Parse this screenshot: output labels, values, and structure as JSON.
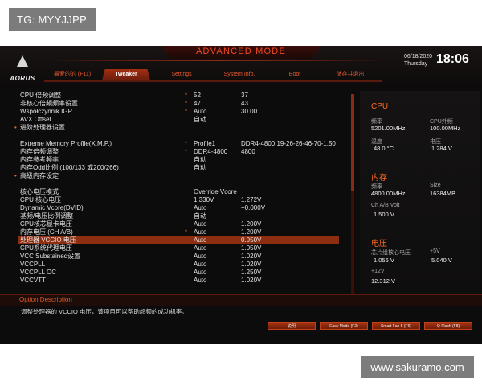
{
  "overlay": {
    "tg_label": "TG: MYYJJPP",
    "watermark_url": "www.sakuramo.com"
  },
  "header": {
    "brand": "AORUS",
    "mode_title": "ADVANCED MODE",
    "date": "06/18/2020",
    "weekday": "Thursday",
    "time": "18:06"
  },
  "tabs": [
    {
      "label": "最爱的的 (F11)",
      "active": false
    },
    {
      "label": "Tweaker",
      "active": true
    },
    {
      "label": "Settings",
      "active": false
    },
    {
      "label": "System Info.",
      "active": false
    },
    {
      "label": "Boot",
      "active": false
    },
    {
      "label": "储存并退出",
      "active": false
    }
  ],
  "settings": [
    {
      "label": "CPU 倍频调整",
      "star": true,
      "v1": "52",
      "v2": "37",
      "bullet": false,
      "selected": false
    },
    {
      "label": "非核心倍频频率设置",
      "star": true,
      "v1": "47",
      "v2": "43",
      "bullet": false,
      "selected": false
    },
    {
      "label": "Współczynnik IGP",
      "star": true,
      "v1": "Auto",
      "v2": "30.00",
      "bullet": false,
      "selected": false
    },
    {
      "label": "AVX Offset",
      "star": false,
      "v1": "自动",
      "v2": "",
      "bullet": false,
      "selected": false
    },
    {
      "label": "进阶处理器设置",
      "star": false,
      "v1": "",
      "v2": "",
      "bullet": true,
      "selected": false
    },
    {
      "label": "",
      "star": false,
      "v1": "",
      "v2": "",
      "bullet": false,
      "selected": false
    },
    {
      "label": "Extreme Memory Profile(X.M.P.)",
      "star": true,
      "v1": "Profile1",
      "v2": "DDR4-4800 19-26-26-46-70-1.50",
      "bullet": false,
      "selected": false
    },
    {
      "label": "内存倍频调整",
      "star": true,
      "v1": "DDR4-4800",
      "v2": "4800",
      "bullet": false,
      "selected": false
    },
    {
      "label": "内存参考频率",
      "star": false,
      "v1": "自动",
      "v2": "",
      "bullet": false,
      "selected": false
    },
    {
      "label": "内存Odd比例 (100/133 或200/266)",
      "star": false,
      "v1": "自动",
      "v2": "",
      "bullet": false,
      "selected": false
    },
    {
      "label": "高级内存设定",
      "star": false,
      "v1": "",
      "v2": "",
      "bullet": true,
      "selected": false
    },
    {
      "label": "",
      "star": false,
      "v1": "",
      "v2": "",
      "bullet": false,
      "selected": false
    },
    {
      "label": "核心电压模式",
      "star": false,
      "v1": "Override Vcore",
      "v2": "",
      "bullet": false,
      "selected": false
    },
    {
      "label": "CPU 核心电压",
      "star": false,
      "v1": "1.330V",
      "v2": "1.272V",
      "bullet": false,
      "selected": false
    },
    {
      "label": "Dynamic Vcore(DVID)",
      "star": false,
      "v1": "Auto",
      "v2": "+0.000V",
      "bullet": false,
      "selected": false
    },
    {
      "label": "基频/电压比例调整",
      "star": false,
      "v1": "自动",
      "v2": "",
      "bullet": false,
      "selected": false
    },
    {
      "label": "CPU核芯显卡电压",
      "star": false,
      "v1": "Auto",
      "v2": "1.200V",
      "bullet": false,
      "selected": false
    },
    {
      "label": "内存电压 (CH A/B)",
      "star": true,
      "v1": "Auto",
      "v2": "1.200V",
      "bullet": false,
      "selected": false
    },
    {
      "label": "处理器 VCCIO 电压",
      "star": false,
      "v1": "Auto",
      "v2": "0.950V",
      "bullet": false,
      "selected": true
    },
    {
      "label": "CPU系统代理电压",
      "star": false,
      "v1": "Auto",
      "v2": "1.050V",
      "bullet": false,
      "selected": false
    },
    {
      "label": "VCC Substained设置",
      "star": false,
      "v1": "Auto",
      "v2": "1.020V",
      "bullet": false,
      "selected": false
    },
    {
      "label": "VCCPLL",
      "star": false,
      "v1": "Auto",
      "v2": "1.020V",
      "bullet": false,
      "selected": false
    },
    {
      "label": "VCCPLL OC",
      "star": false,
      "v1": "Auto",
      "v2": "1.250V",
      "bullet": false,
      "selected": false
    },
    {
      "label": "VCCVTT",
      "star": false,
      "v1": "Auto",
      "v2": "1.020V",
      "bullet": false,
      "selected": false
    }
  ],
  "right_panel": {
    "cpu": {
      "title": "CPU",
      "freq_label": "频率",
      "freq_value": "5201.00MHz",
      "bclk_label": "CPU外频",
      "bclk_value": "100.00MHz",
      "temp_label": "温度",
      "temp_value": "48.0 °C",
      "volt_label": "电压",
      "volt_value": "1.284 V"
    },
    "memory": {
      "title": "内存",
      "freq_label": "频率",
      "freq_value": "4800.00MHz",
      "size_label": "Size",
      "size_value": "16384MB",
      "volt_label": "Ch A/B Volt",
      "volt_value": "1.500 V"
    },
    "voltage": {
      "title": "电压",
      "cpu_label": "芯片组核心电压",
      "cpu_value": "1.056 V",
      "p5v_label": "+5V",
      "p5v_value": "5.040 V",
      "p12v_label": "+12V",
      "p12v_value": "12.312 V"
    }
  },
  "option_description": {
    "title": "Option Description",
    "text": "调整处理器的 VCCIO 电压，该项目可以帮助超频的成功机率。"
  },
  "bottom_buttons": [
    {
      "label": "说明"
    },
    {
      "label": "Easy Mode (F2)"
    },
    {
      "label": "Smart Fan 5 (F6)"
    },
    {
      "label": "Q-Flash (F8)"
    }
  ]
}
